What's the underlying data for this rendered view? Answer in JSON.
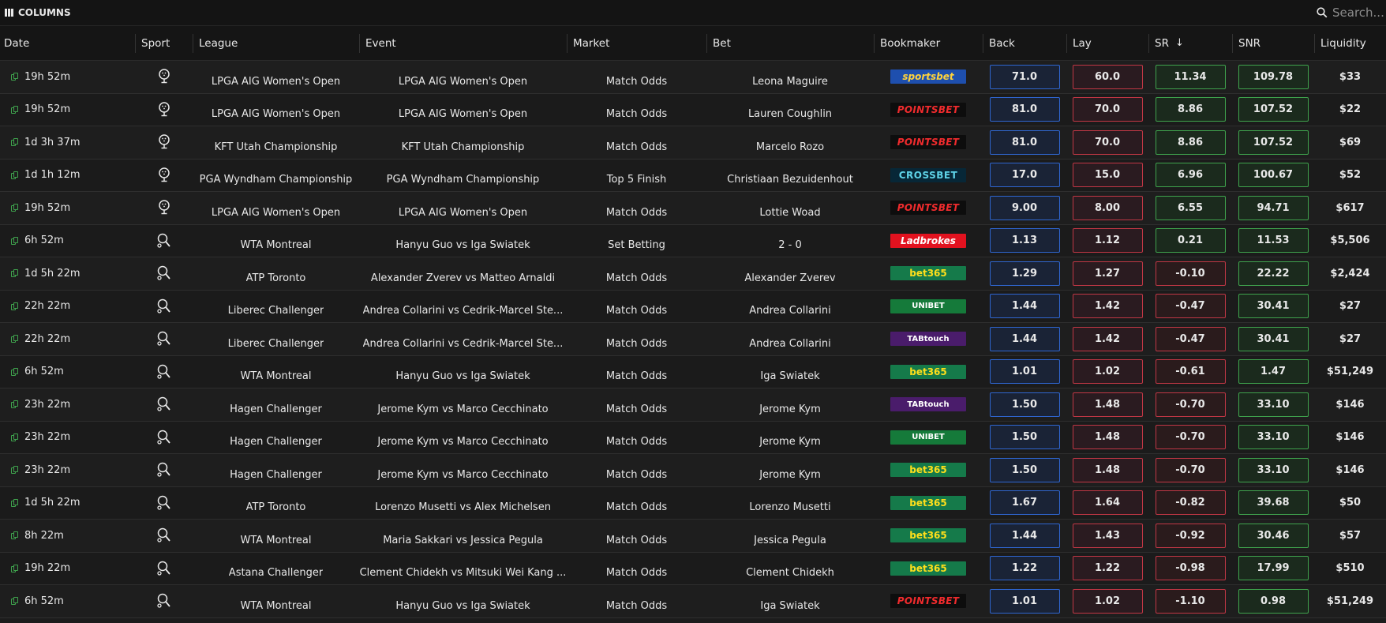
{
  "toolbar": {
    "columns_label": "COLUMNS",
    "search_placeholder": "Search..."
  },
  "headers": {
    "date": "Date",
    "sport": "Sport",
    "league": "League",
    "event": "Event",
    "market": "Market",
    "bet": "Bet",
    "bookmaker": "Bookmaker",
    "back": "Back",
    "lay": "Lay",
    "sr": "SR",
    "snr": "SNR",
    "liquidity": "Liquidity"
  },
  "sort": {
    "column": "SR",
    "direction": "descending"
  },
  "rows": [
    {
      "date": "19h 52m",
      "sport": "golf",
      "league": "LPGA AIG Women's Open",
      "event": "LPGA AIG Women's Open",
      "market": "Match Odds",
      "bet": "Leona Maguire",
      "bookmaker": "sportsbet",
      "back": "71.0",
      "lay": "60.0",
      "sr": "11.34",
      "sr_sign": "pos",
      "snr": "109.78",
      "liquidity": "$33"
    },
    {
      "date": "19h 52m",
      "sport": "golf",
      "league": "LPGA AIG Women's Open",
      "event": "LPGA AIG Women's Open",
      "market": "Match Odds",
      "bet": "Lauren Coughlin",
      "bookmaker": "POINTSBET",
      "back": "81.0",
      "lay": "70.0",
      "sr": "8.86",
      "sr_sign": "pos",
      "snr": "107.52",
      "liquidity": "$22"
    },
    {
      "date": "1d 3h 37m",
      "sport": "golf",
      "league": "KFT Utah Championship",
      "event": "KFT Utah Championship",
      "market": "Match Odds",
      "bet": "Marcelo Rozo",
      "bookmaker": "POINTSBET",
      "back": "81.0",
      "lay": "70.0",
      "sr": "8.86",
      "sr_sign": "pos",
      "snr": "107.52",
      "liquidity": "$69"
    },
    {
      "date": "1d 1h 12m",
      "sport": "golf",
      "league": "PGA Wyndham Championship",
      "event": "PGA Wyndham Championship",
      "market": "Top 5 Finish",
      "bet": "Christiaan Bezuidenhout",
      "bookmaker": "CROSSBET",
      "back": "17.0",
      "lay": "15.0",
      "sr": "6.96",
      "sr_sign": "pos",
      "snr": "100.67",
      "liquidity": "$52"
    },
    {
      "date": "19h 52m",
      "sport": "golf",
      "league": "LPGA AIG Women's Open",
      "event": "LPGA AIG Women's Open",
      "market": "Match Odds",
      "bet": "Lottie Woad",
      "bookmaker": "POINTSBET",
      "back": "9.00",
      "lay": "8.00",
      "sr": "6.55",
      "sr_sign": "pos",
      "snr": "94.71",
      "liquidity": "$617"
    },
    {
      "date": "6h 52m",
      "sport": "tennis",
      "league": "WTA Montreal",
      "event": "Hanyu Guo vs Iga Swiatek",
      "market": "Set Betting",
      "bet": "2 - 0",
      "bookmaker": "Ladbrokes",
      "back": "1.13",
      "lay": "1.12",
      "sr": "0.21",
      "sr_sign": "pos",
      "snr": "11.53",
      "liquidity": "$5,506"
    },
    {
      "date": "1d 5h 22m",
      "sport": "tennis",
      "league": "ATP Toronto",
      "event": "Alexander Zverev vs Matteo Arnaldi",
      "market": "Match Odds",
      "bet": "Alexander Zverev",
      "bookmaker": "bet365",
      "back": "1.29",
      "lay": "1.27",
      "sr": "-0.10",
      "sr_sign": "neg",
      "snr": "22.22",
      "liquidity": "$2,424"
    },
    {
      "date": "22h 22m",
      "sport": "tennis",
      "league": "Liberec Challenger",
      "event": "Andrea Collarini vs Cedrik-Marcel Ste...",
      "market": "Match Odds",
      "bet": "Andrea Collarini",
      "bookmaker": "UNIBET",
      "back": "1.44",
      "lay": "1.42",
      "sr": "-0.47",
      "sr_sign": "neg",
      "snr": "30.41",
      "liquidity": "$27"
    },
    {
      "date": "22h 22m",
      "sport": "tennis",
      "league": "Liberec Challenger",
      "event": "Andrea Collarini vs Cedrik-Marcel Ste...",
      "market": "Match Odds",
      "bet": "Andrea Collarini",
      "bookmaker": "TABtouch",
      "back": "1.44",
      "lay": "1.42",
      "sr": "-0.47",
      "sr_sign": "neg",
      "snr": "30.41",
      "liquidity": "$27"
    },
    {
      "date": "6h 52m",
      "sport": "tennis",
      "league": "WTA Montreal",
      "event": "Hanyu Guo vs Iga Swiatek",
      "market": "Match Odds",
      "bet": "Iga Swiatek",
      "bookmaker": "bet365",
      "back": "1.01",
      "lay": "1.02",
      "sr": "-0.61",
      "sr_sign": "neg",
      "snr": "1.47",
      "liquidity": "$51,249"
    },
    {
      "date": "23h 22m",
      "sport": "tennis",
      "league": "Hagen Challenger",
      "event": "Jerome Kym vs Marco Cecchinato",
      "market": "Match Odds",
      "bet": "Jerome Kym",
      "bookmaker": "TABtouch",
      "back": "1.50",
      "lay": "1.48",
      "sr": "-0.70",
      "sr_sign": "neg",
      "snr": "33.10",
      "liquidity": "$146"
    },
    {
      "date": "23h 22m",
      "sport": "tennis",
      "league": "Hagen Challenger",
      "event": "Jerome Kym vs Marco Cecchinato",
      "market": "Match Odds",
      "bet": "Jerome Kym",
      "bookmaker": "UNIBET",
      "back": "1.50",
      "lay": "1.48",
      "sr": "-0.70",
      "sr_sign": "neg",
      "snr": "33.10",
      "liquidity": "$146"
    },
    {
      "date": "23h 22m",
      "sport": "tennis",
      "league": "Hagen Challenger",
      "event": "Jerome Kym vs Marco Cecchinato",
      "market": "Match Odds",
      "bet": "Jerome Kym",
      "bookmaker": "bet365",
      "back": "1.50",
      "lay": "1.48",
      "sr": "-0.70",
      "sr_sign": "neg",
      "snr": "33.10",
      "liquidity": "$146"
    },
    {
      "date": "1d 5h 22m",
      "sport": "tennis",
      "league": "ATP Toronto",
      "event": "Lorenzo Musetti vs Alex Michelsen",
      "market": "Match Odds",
      "bet": "Lorenzo Musetti",
      "bookmaker": "bet365",
      "back": "1.67",
      "lay": "1.64",
      "sr": "-0.82",
      "sr_sign": "neg",
      "snr": "39.68",
      "liquidity": "$50"
    },
    {
      "date": "8h 22m",
      "sport": "tennis",
      "league": "WTA Montreal",
      "event": "Maria Sakkari vs Jessica Pegula",
      "market": "Match Odds",
      "bet": "Jessica Pegula",
      "bookmaker": "bet365",
      "back": "1.44",
      "lay": "1.43",
      "sr": "-0.92",
      "sr_sign": "neg",
      "snr": "30.46",
      "liquidity": "$57"
    },
    {
      "date": "19h 22m",
      "sport": "tennis",
      "league": "Astana Challenger",
      "event": "Clement Chidekh vs Mitsuki Wei Kang ...",
      "market": "Match Odds",
      "bet": "Clement Chidekh",
      "bookmaker": "bet365",
      "back": "1.22",
      "lay": "1.22",
      "sr": "-0.98",
      "sr_sign": "neg",
      "snr": "17.99",
      "liquidity": "$510"
    },
    {
      "date": "6h 52m",
      "sport": "tennis",
      "league": "WTA Montreal",
      "event": "Hanyu Guo vs Iga Swiatek",
      "market": "Match Odds",
      "bet": "Iga Swiatek",
      "bookmaker": "POINTSBET",
      "back": "1.01",
      "lay": "1.02",
      "sr": "-1.10",
      "sr_sign": "neg",
      "snr": "0.98",
      "liquidity": "$51,249"
    }
  ]
}
